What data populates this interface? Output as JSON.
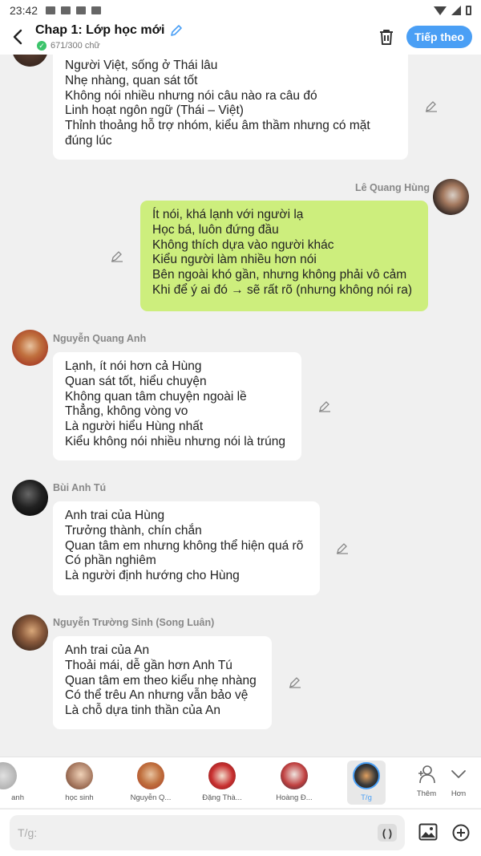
{
  "status": {
    "time": "23:42"
  },
  "header": {
    "title": "Chap 1: Lớp học mới",
    "word_count": "671/300 chữ",
    "next_label": "Tiếp theo"
  },
  "messages": [
    {
      "text": "Người Việt, sống ở Thái lâu\nNhẹ nhàng, quan sát tốt\nKhông nói nhiều nhưng nói câu nào ra câu đó\nLinh hoạt ngôn ngữ (Thái – Việt)\nThỉnh thoảng hỗ trợ nhóm, kiểu âm thầm nhưng có mặt\nđúng lúc"
    },
    {
      "sender": "Lê Quang Hùng",
      "text": "Ít nói, khá lạnh với người lạ\nHọc bá, luôn đứng đầu\nKhông thích dựa vào người khác\nKiểu người làm nhiều hơn nói\nBên ngoài khó gần, nhưng không phải vô cảm\nKhi để ý ai đó → sẽ rất rõ (nhưng không nói ra)"
    },
    {
      "sender": "Nguyễn Quang Anh",
      "text": "Lạnh, ít nói hơn cả Hùng\nQuan sát tốt, hiểu chuyện\nKhông quan tâm chuyện ngoài lề\nThẳng, không vòng vo\nLà người hiểu Hùng nhất\nKiểu không nói nhiều nhưng nói là trúng"
    },
    {
      "sender": "Bùi Anh Tú",
      "text": "Anh trai của Hùng\nTrưởng thành, chín chắn\nQuan tâm em nhưng không thể hiện quá rõ\nCó phần nghiêm\nLà người định hướng cho Hùng"
    },
    {
      "sender": "Nguyễn Trường Sinh (Song Luân)",
      "text": "Anh trai của An\nThoải mái, dễ gần hơn Anh Tú\nQuan tâm em theo kiểu nhẹ nhàng\nCó thể trêu An nhưng vẫn bảo vệ\nLà chỗ dựa tinh thần của An"
    }
  ],
  "characters": [
    {
      "label": "anh"
    },
    {
      "label": "học sinh"
    },
    {
      "label": "Nguyễn Q..."
    },
    {
      "label": "Đặng Thà..."
    },
    {
      "label": "Hoàng Đ..."
    },
    {
      "label": "T/g"
    }
  ],
  "actions": {
    "more": "Thêm",
    "less": "Hơn"
  },
  "composer": {
    "placeholder": "T/g:",
    "paren": "( )"
  },
  "colors": {
    "accent": "#4a9ff5",
    "my_bubble": "#cdee7d",
    "ok": "#3cc46b"
  }
}
